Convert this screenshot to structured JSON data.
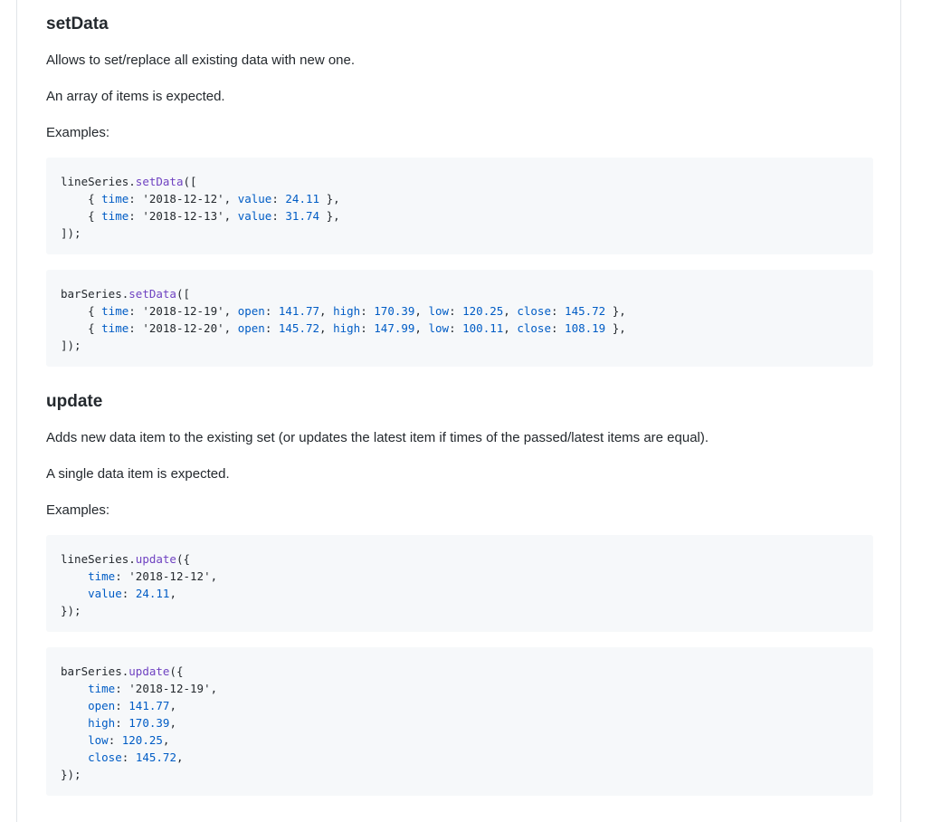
{
  "sections": [
    {
      "heading": "setData",
      "description": "Allows to set/replace all existing data with new one.",
      "expected": "An array of items is expected.",
      "examples_label": "Examples:",
      "code_blocks": [
        {
          "lines": [
            [
              {
                "t": "plain",
                "v": "lineSeries."
              },
              {
                "t": "fn",
                "v": "setData"
              },
              {
                "t": "plain",
                "v": "(["
              }
            ],
            [
              {
                "t": "plain",
                "v": "    { "
              },
              {
                "t": "key",
                "v": "time"
              },
              {
                "t": "plain",
                "v": ": "
              },
              {
                "t": "str",
                "v": "'2018-12-12'"
              },
              {
                "t": "plain",
                "v": ", "
              },
              {
                "t": "key",
                "v": "value"
              },
              {
                "t": "plain",
                "v": ": "
              },
              {
                "t": "num",
                "v": "24.11"
              },
              {
                "t": "plain",
                "v": " },"
              }
            ],
            [
              {
                "t": "plain",
                "v": "    { "
              },
              {
                "t": "key",
                "v": "time"
              },
              {
                "t": "plain",
                "v": ": "
              },
              {
                "t": "str",
                "v": "'2018-12-13'"
              },
              {
                "t": "plain",
                "v": ", "
              },
              {
                "t": "key",
                "v": "value"
              },
              {
                "t": "plain",
                "v": ": "
              },
              {
                "t": "num",
                "v": "31.74"
              },
              {
                "t": "plain",
                "v": " },"
              }
            ],
            [
              {
                "t": "plain",
                "v": "]);"
              }
            ]
          ]
        },
        {
          "lines": [
            [
              {
                "t": "plain",
                "v": "barSeries."
              },
              {
                "t": "fn",
                "v": "setData"
              },
              {
                "t": "plain",
                "v": "(["
              }
            ],
            [
              {
                "t": "plain",
                "v": "    { "
              },
              {
                "t": "key",
                "v": "time"
              },
              {
                "t": "plain",
                "v": ": "
              },
              {
                "t": "str",
                "v": "'2018-12-19'"
              },
              {
                "t": "plain",
                "v": ", "
              },
              {
                "t": "key",
                "v": "open"
              },
              {
                "t": "plain",
                "v": ": "
              },
              {
                "t": "num",
                "v": "141.77"
              },
              {
                "t": "plain",
                "v": ", "
              },
              {
                "t": "key",
                "v": "high"
              },
              {
                "t": "plain",
                "v": ": "
              },
              {
                "t": "num",
                "v": "170.39"
              },
              {
                "t": "plain",
                "v": ", "
              },
              {
                "t": "key",
                "v": "low"
              },
              {
                "t": "plain",
                "v": ": "
              },
              {
                "t": "num",
                "v": "120.25"
              },
              {
                "t": "plain",
                "v": ", "
              },
              {
                "t": "key",
                "v": "close"
              },
              {
                "t": "plain",
                "v": ": "
              },
              {
                "t": "num",
                "v": "145.72"
              },
              {
                "t": "plain",
                "v": " },"
              }
            ],
            [
              {
                "t": "plain",
                "v": "    { "
              },
              {
                "t": "key",
                "v": "time"
              },
              {
                "t": "plain",
                "v": ": "
              },
              {
                "t": "str",
                "v": "'2018-12-20'"
              },
              {
                "t": "plain",
                "v": ", "
              },
              {
                "t": "key",
                "v": "open"
              },
              {
                "t": "plain",
                "v": ": "
              },
              {
                "t": "num",
                "v": "145.72"
              },
              {
                "t": "plain",
                "v": ", "
              },
              {
                "t": "key",
                "v": "high"
              },
              {
                "t": "plain",
                "v": ": "
              },
              {
                "t": "num",
                "v": "147.99"
              },
              {
                "t": "plain",
                "v": ", "
              },
              {
                "t": "key",
                "v": "low"
              },
              {
                "t": "plain",
                "v": ": "
              },
              {
                "t": "num",
                "v": "100.11"
              },
              {
                "t": "plain",
                "v": ", "
              },
              {
                "t": "key",
                "v": "close"
              },
              {
                "t": "plain",
                "v": ": "
              },
              {
                "t": "num",
                "v": "108.19"
              },
              {
                "t": "plain",
                "v": " },"
              }
            ],
            [
              {
                "t": "plain",
                "v": "]);"
              }
            ]
          ]
        }
      ]
    },
    {
      "heading": "update",
      "description": "Adds new data item to the existing set (or updates the latest item if times of the passed/latest items are equal).",
      "expected": "A single data item is expected.",
      "examples_label": "Examples:",
      "code_blocks": [
        {
          "lines": [
            [
              {
                "t": "plain",
                "v": "lineSeries."
              },
              {
                "t": "fn",
                "v": "update"
              },
              {
                "t": "plain",
                "v": "({"
              }
            ],
            [
              {
                "t": "plain",
                "v": "    "
              },
              {
                "t": "key",
                "v": "time"
              },
              {
                "t": "plain",
                "v": ": "
              },
              {
                "t": "str",
                "v": "'2018-12-12'"
              },
              {
                "t": "plain",
                "v": ","
              }
            ],
            [
              {
                "t": "plain",
                "v": "    "
              },
              {
                "t": "key",
                "v": "value"
              },
              {
                "t": "plain",
                "v": ": "
              },
              {
                "t": "num",
                "v": "24.11"
              },
              {
                "t": "plain",
                "v": ","
              }
            ],
            [
              {
                "t": "plain",
                "v": "});"
              }
            ]
          ]
        },
        {
          "lines": [
            [
              {
                "t": "plain",
                "v": "barSeries."
              },
              {
                "t": "fn",
                "v": "update"
              },
              {
                "t": "plain",
                "v": "({"
              }
            ],
            [
              {
                "t": "plain",
                "v": "    "
              },
              {
                "t": "key",
                "v": "time"
              },
              {
                "t": "plain",
                "v": ": "
              },
              {
                "t": "str",
                "v": "'2018-12-19'"
              },
              {
                "t": "plain",
                "v": ","
              }
            ],
            [
              {
                "t": "plain",
                "v": "    "
              },
              {
                "t": "key",
                "v": "open"
              },
              {
                "t": "plain",
                "v": ": "
              },
              {
                "t": "num",
                "v": "141.77"
              },
              {
                "t": "plain",
                "v": ","
              }
            ],
            [
              {
                "t": "plain",
                "v": "    "
              },
              {
                "t": "key",
                "v": "high"
              },
              {
                "t": "plain",
                "v": ": "
              },
              {
                "t": "num",
                "v": "170.39"
              },
              {
                "t": "plain",
                "v": ","
              }
            ],
            [
              {
                "t": "plain",
                "v": "    "
              },
              {
                "t": "key",
                "v": "low"
              },
              {
                "t": "plain",
                "v": ": "
              },
              {
                "t": "num",
                "v": "120.25"
              },
              {
                "t": "plain",
                "v": ","
              }
            ],
            [
              {
                "t": "plain",
                "v": "    "
              },
              {
                "t": "key",
                "v": "close"
              },
              {
                "t": "plain",
                "v": ": "
              },
              {
                "t": "num",
                "v": "145.72"
              },
              {
                "t": "plain",
                "v": ","
              }
            ],
            [
              {
                "t": "plain",
                "v": "});"
              }
            ]
          ]
        }
      ]
    }
  ],
  "colors": {
    "code_background": "#f6f8fa",
    "syntax_key": "#005cc5",
    "syntax_function": "#6f42c1",
    "text": "#24292e"
  }
}
